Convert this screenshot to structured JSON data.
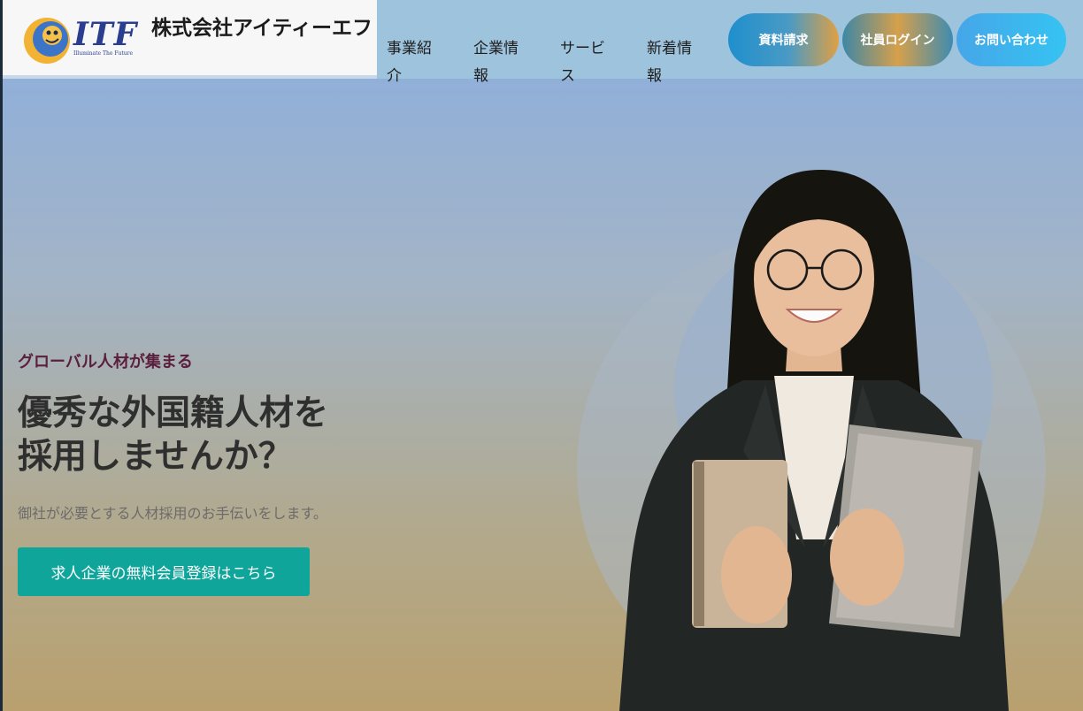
{
  "logo": {
    "mark_text": "ITF",
    "tagline": "Illuminate The Future",
    "icon": "itf-logo-icon"
  },
  "company_name": "株式会社アイティーエフ",
  "nav": [
    {
      "line1": "事業紹",
      "line2": "介"
    },
    {
      "line1": "企業情",
      "line2": "報"
    },
    {
      "line1": "サービ",
      "line2": "ス"
    },
    {
      "line1": "新着情",
      "line2": "報"
    }
  ],
  "buttons": {
    "docs": "資料請求",
    "login": "社員ログイン",
    "contact": "お問い合わせ"
  },
  "hero": {
    "eyebrow": "グローバル人材が集まる",
    "headline_line1": "優秀な外国籍人材を",
    "headline_line2": "採用しませんか？",
    "subtext": "御社が必要とする人材採用のお手伝いをします。",
    "cta": "求人企業の無料会員登録はこちら"
  },
  "colors": {
    "header_bg": "#9ec3dc",
    "cta_bg": "#0fa59a",
    "eyebrow": "#5b1f3e",
    "logo_blue": "#2a3d8f"
  }
}
